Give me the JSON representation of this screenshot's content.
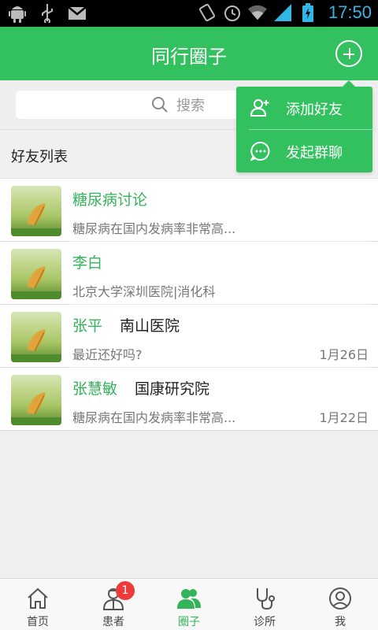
{
  "status_bar": {
    "time": "17:50",
    "left_icons": [
      "android-icon",
      "usb-icon",
      "gmail-icon"
    ],
    "right_icons": [
      "vibrate-icon",
      "alarm-icon",
      "wifi-icon",
      "signal-icon",
      "battery-icon"
    ]
  },
  "header": {
    "title": "同行圈子",
    "add_icon": "plus-circle-icon"
  },
  "search": {
    "placeholder": "搜索",
    "icon": "search-icon"
  },
  "friends_section": {
    "title": "好友列表"
  },
  "dropdown": {
    "items": [
      {
        "label": "添加好友",
        "icon": "add-friend-icon"
      },
      {
        "label": "发起群聊",
        "icon": "chat-bubble-icon"
      }
    ]
  },
  "friends": [
    {
      "name": "糖尿病讨论",
      "hospital": "",
      "subtitle": "糖尿病在国内发病率非常高...",
      "date": ""
    },
    {
      "name": "李白",
      "hospital": "",
      "subtitle": "北京大学深圳医院|消化科",
      "date": ""
    },
    {
      "name": "张平",
      "hospital": "南山医院",
      "subtitle": "最近还好吗?",
      "date": "1月26日"
    },
    {
      "name": "张慧敏",
      "hospital": "国康研究院",
      "subtitle": "糖尿病在国内发病率非常高...",
      "date": "1月22日"
    }
  ],
  "bottom_nav": {
    "items": [
      {
        "label": "首页",
        "icon": "home-icon",
        "active": false
      },
      {
        "label": "患者",
        "icon": "doctor-icon",
        "active": false,
        "badge": "1"
      },
      {
        "label": "圈子",
        "icon": "people-icon",
        "active": true
      },
      {
        "label": "诊所",
        "icon": "stethoscope-icon",
        "active": false
      },
      {
        "label": "我",
        "icon": "profile-icon",
        "active": false
      }
    ]
  },
  "colors": {
    "primary": "#33c160",
    "name_text": "#33b35a",
    "badge": "#ee3a3a",
    "status_time": "#33b5e5"
  }
}
